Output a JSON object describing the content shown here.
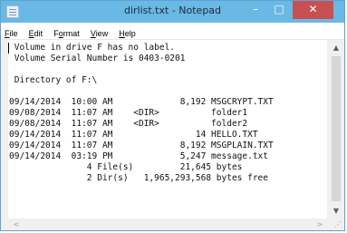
{
  "window": {
    "title": "dirlist.txt - Notepad",
    "controls": {
      "minimize": "–",
      "maximize": "□",
      "close": "✕"
    }
  },
  "menu": [
    {
      "label": "File",
      "key": "F"
    },
    {
      "label": "Edit",
      "key": "E"
    },
    {
      "label": "Format",
      "key": "o"
    },
    {
      "label": "View",
      "key": "V"
    },
    {
      "label": "Help",
      "key": "H"
    }
  ],
  "document": {
    "lines": [
      " Volume in drive F has no label.",
      " Volume Serial Number is 0403-0201",
      "",
      " Directory of F:\\",
      "",
      "09/14/2014  10:00 AM             8,192 MSGCRYPT.TXT",
      "09/08/2014  11:07 AM    <DIR>          folder1",
      "09/08/2014  11:07 AM    <DIR>          folder2",
      "09/14/2014  11:07 AM                14 HELLO.TXT",
      "09/14/2014  11:07 AM             8,192 MSGPLAIN.TXT",
      "09/14/2014  03:19 PM             5,247 message.txt",
      "               4 File(s)         21,645 bytes",
      "               2 Dir(s)   1,965,293,568 bytes free"
    ]
  },
  "scrollbar": {
    "up_arrow": "▲",
    "down_arrow": "▼",
    "left_arrow": "<",
    "right_arrow": ">"
  }
}
